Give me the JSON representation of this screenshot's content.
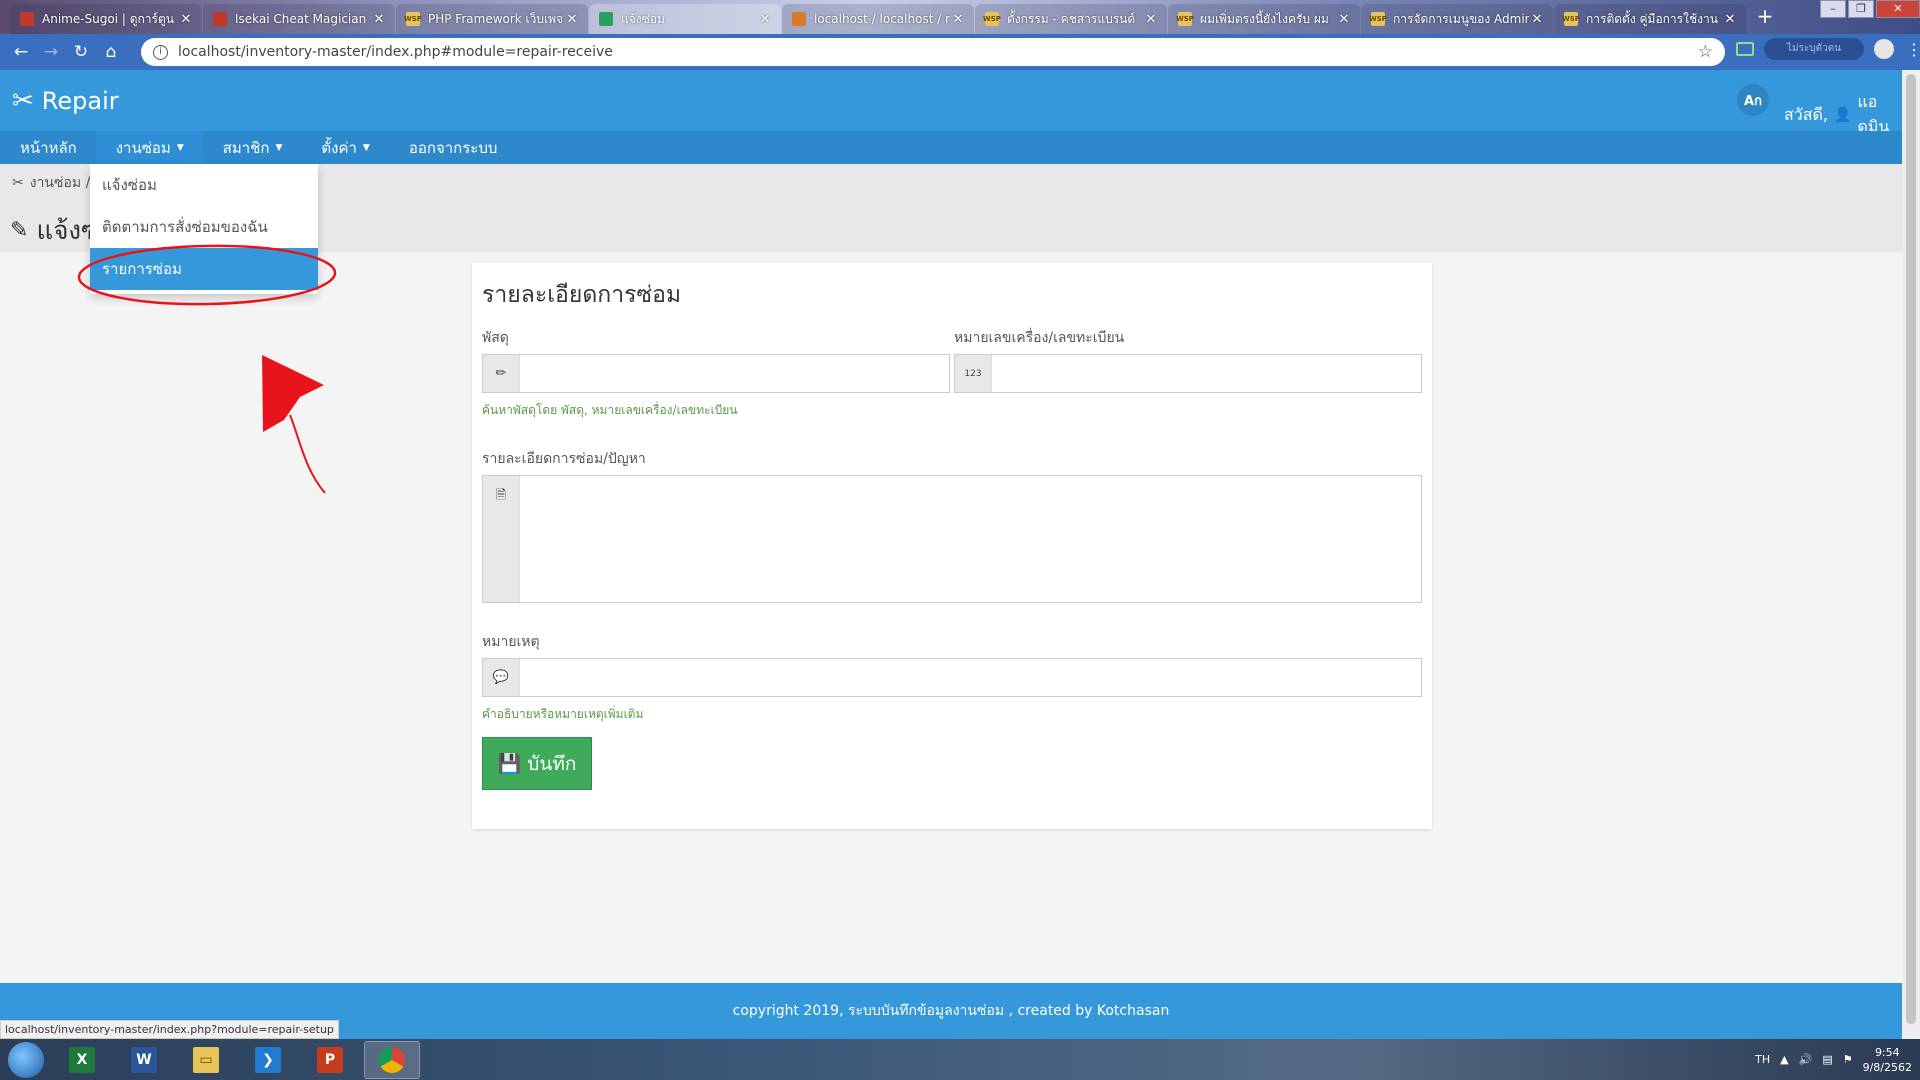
{
  "browser": {
    "tabs": [
      {
        "title": "Anime-Sugoi | ดูการ์ตูน",
        "fav_bg": "#c0392b",
        "fav_text": ""
      },
      {
        "title": "Isekai Cheat Magician",
        "fav_bg": "#c0392b",
        "fav_text": ""
      },
      {
        "title": "PHP Framework เว็บเพจ",
        "fav_bg": "#e8c35a",
        "fav_text": "WSP"
      },
      {
        "title": "แจ้งซ่อม",
        "fav_bg": "#2aa05a",
        "fav_text": ""
      },
      {
        "title": "localhost / localhost / r",
        "fav_bg": "#d87a2a",
        "fav_text": ""
      },
      {
        "title": "ตั้งกรรม - คชสารแบรนด์",
        "fav_bg": "#e8c35a",
        "fav_text": "WSP"
      },
      {
        "title": "ผมเพิ่มตรงนี้ยังไงครับ ผม",
        "fav_bg": "#e8c35a",
        "fav_text": "WSP"
      },
      {
        "title": "การจัดการเมนูของ Admin",
        "fav_bg": "#e8c35a",
        "fav_text": "WSP"
      },
      {
        "title": "การติดตั้ง คู่มือการใช้งาน",
        "fav_bg": "#e8c35a",
        "fav_text": "WSP"
      }
    ],
    "new_tab": "+",
    "url": "localhost/inventory-master/index.php#module=repair-receive",
    "status_url": "localhost/inventory-master/index.php?module=repair-setup",
    "extension_label": "ไม่ระบุตัวตน"
  },
  "app": {
    "brand": "Repair",
    "lang": "Aก",
    "greeting": "สวัสดี,",
    "user": "แอดมิน"
  },
  "menu": {
    "items": [
      {
        "label": "หน้าหลัก",
        "caret": false
      },
      {
        "label": "งานซ่อม",
        "caret": true
      },
      {
        "label": "สมาชิก",
        "caret": true
      },
      {
        "label": "ตั้งค่า",
        "caret": true
      },
      {
        "label": "ออกจากระบบ",
        "caret": false
      }
    ],
    "dropdown": [
      "แจ้งซ่อม",
      "ติดตามการสั่งซ่อมของฉัน",
      "รายการซ่อม"
    ]
  },
  "page": {
    "breadcrumb": "งานซ่อม /",
    "title": "แจ้งซ่อม"
  },
  "form": {
    "heading": "รายละเอียดการซ่อม",
    "product_label": "พัสดุ",
    "serial_label": "หมายเลขเครื่อง/เลขทะเบียน",
    "search_hint": "ค้นหาพัสดุโดย พัสดุ, หมายเลขเครื่อง/เลขทะเบียน",
    "detail_label": "รายละเอียดการซ่อม/ปัญหา",
    "comment_label": "หมายเหตุ",
    "comment_hint": "คำอธิบายหรือหมายเหตุเพิ่มเติม",
    "save": "บันทึก",
    "serial_icon": "123"
  },
  "footer": {
    "text": "copyright 2019, ระบบบันทึกข้อมูลงานซ่อม , created by Kotchasan"
  },
  "taskbar": {
    "apps": [
      {
        "name": "excel",
        "glyph": "X"
      },
      {
        "name": "word",
        "glyph": "W"
      },
      {
        "name": "explorer",
        "glyph": "▭"
      },
      {
        "name": "vscode",
        "glyph": "❯"
      },
      {
        "name": "ppt",
        "glyph": "P"
      },
      {
        "name": "chrome",
        "glyph": ""
      }
    ],
    "lang": "TH",
    "time": "9:54",
    "date": "9/8/2562"
  },
  "colors": {
    "primary": "#3498db",
    "save": "#3faa5a",
    "hint": "#5a9a4a",
    "annotation": "#e8141c"
  }
}
